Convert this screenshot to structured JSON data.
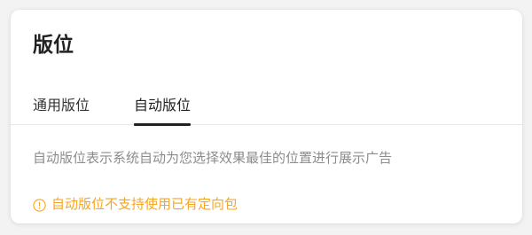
{
  "card": {
    "title": "版位"
  },
  "tabs": [
    {
      "label": "通用版位",
      "active": false
    },
    {
      "label": "自动版位",
      "active": true
    }
  ],
  "description": "自动版位表示系统自动为您选择效果最佳的位置进行展示广告",
  "warning": {
    "icon": "info-circle-icon",
    "text": "自动版位不支持使用已有定向包",
    "color": "#f5a623"
  }
}
